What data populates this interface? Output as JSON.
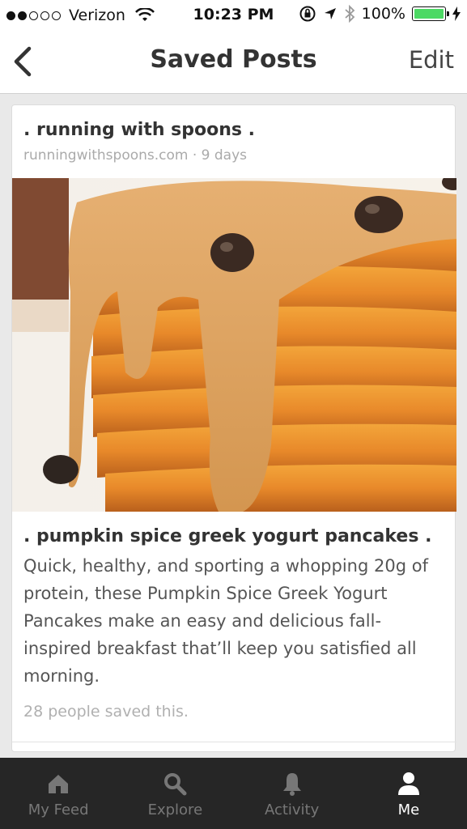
{
  "status_bar": {
    "carrier": "Verizon",
    "time": "10:23 PM",
    "battery": "100%",
    "signal_bars_filled": 2,
    "signal_bars_total": 5
  },
  "nav": {
    "title": "Saved Posts",
    "edit_label": "Edit"
  },
  "post": {
    "source_name": ". running with spoons .",
    "meta": "runningwithspoons.com · 9 days",
    "image_icon": "pumpkin-pancakes-photo",
    "title": ". pumpkin spice greek yogurt pancakes .",
    "description": "Quick, healthy, and sporting a whopping 20g of protein, these Pumpkin Spice Greek Yogurt Pancakes make an easy and delicious fall-inspired breakfast that’ll keep you satisfied all morning.",
    "saved_count_text": "28 people saved this."
  },
  "tabs": [
    {
      "label": "My Feed",
      "icon": "home-icon",
      "active": false
    },
    {
      "label": "Explore",
      "icon": "search-icon",
      "active": false
    },
    {
      "label": "Activity",
      "icon": "bell-icon",
      "active": false
    },
    {
      "label": "Me",
      "icon": "person-icon",
      "active": true
    }
  ],
  "colors": {
    "battery_green": "#4cd964",
    "tab_bar_bg": "#262626",
    "tab_inactive": "#777777",
    "tab_active": "#ffffff"
  }
}
